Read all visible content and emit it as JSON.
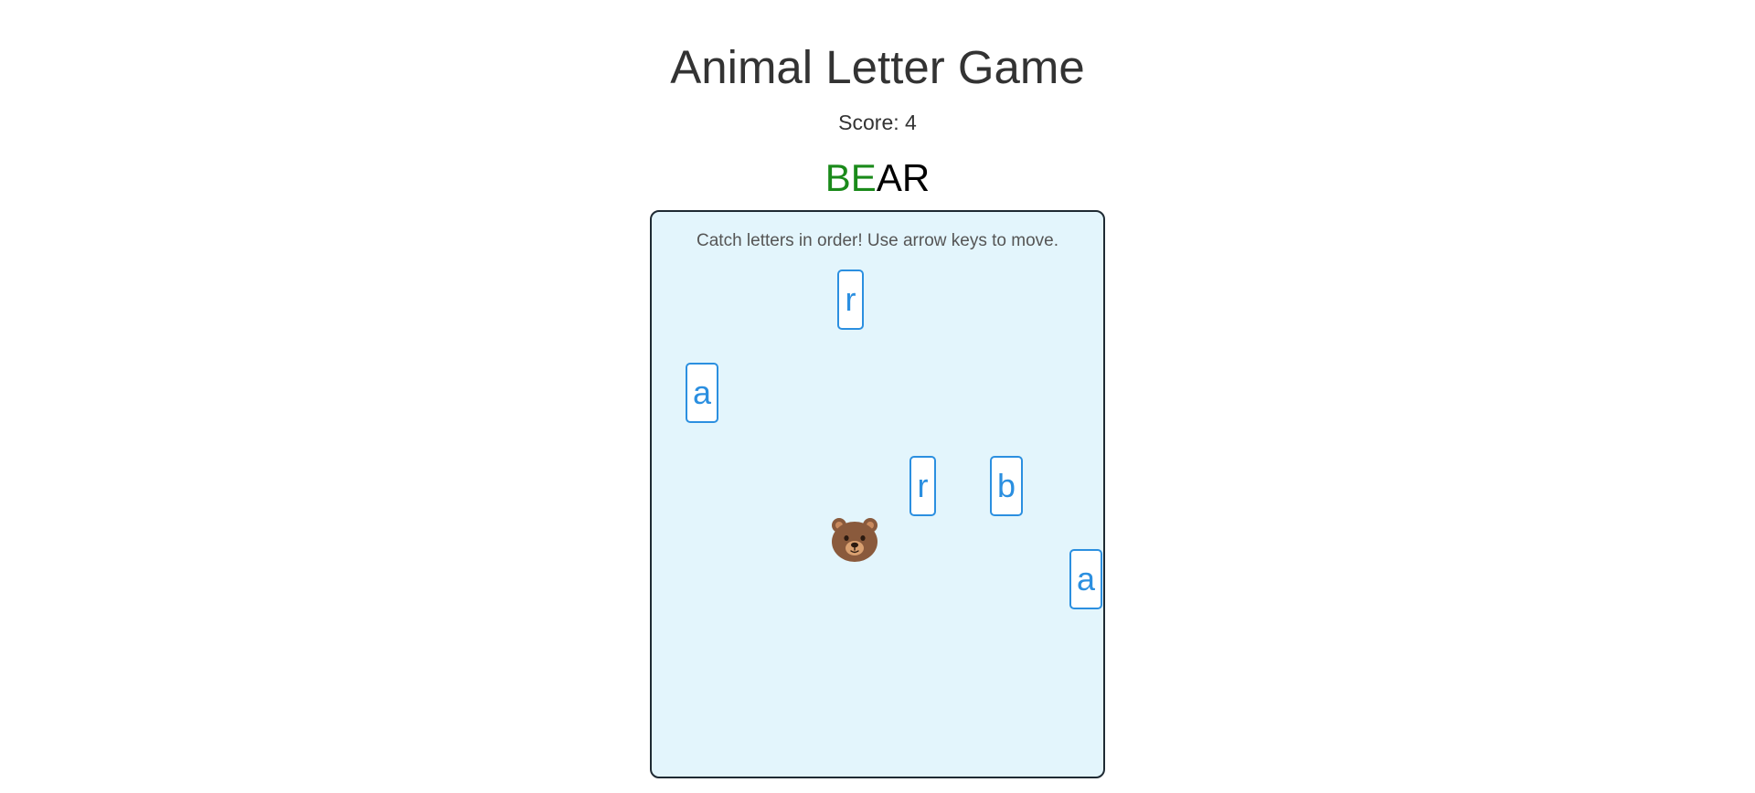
{
  "header": {
    "title": "Animal Letter Game",
    "score_label": "Score:",
    "score_value": "4"
  },
  "target_word": {
    "caught": "BE",
    "remaining": "AR"
  },
  "game": {
    "instructions": "Catch letters in order! Use arrow keys to move.",
    "player_icon": "bear-face-icon",
    "letters": [
      "r",
      "a",
      "r",
      "b",
      "a"
    ]
  },
  "colors": {
    "caught": "#1a8a1a",
    "letter": "#2b8fe0",
    "board_bg": "#e3f5fc",
    "bear": "#8a5a3c"
  }
}
